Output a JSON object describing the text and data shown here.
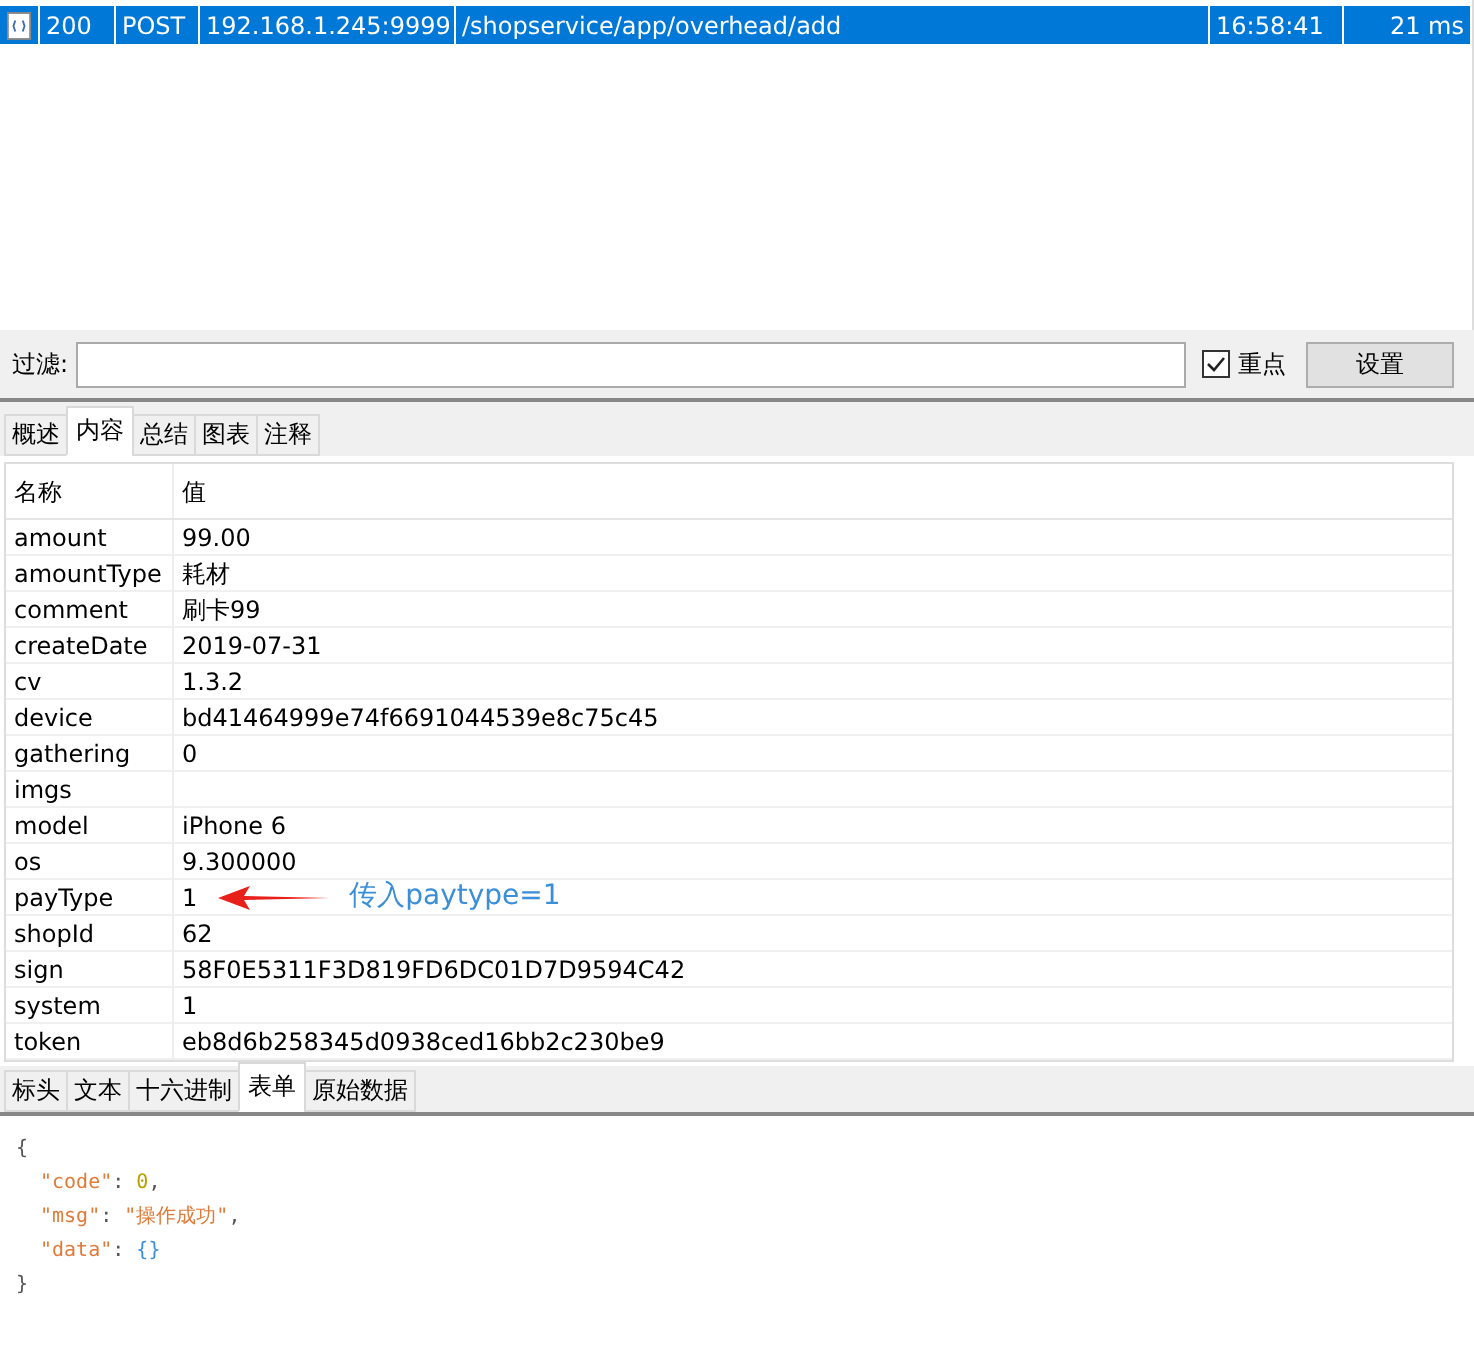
{
  "sessions": [
    {
      "result": "200",
      "method": "POST",
      "host": "192.168.1.245:9999",
      "url": "/shopservice/app/overhead/add",
      "time": "16:58:41",
      "duration": "21 ms",
      "selected": true
    }
  ],
  "filter": {
    "label": "过滤:",
    "emphasis_label": "重点",
    "emphasis_checked": true,
    "settings_button": "设置"
  },
  "tabs": [
    {
      "label": "概述",
      "selected": false
    },
    {
      "label": "内容",
      "selected": true
    },
    {
      "label": "总结",
      "selected": false
    },
    {
      "label": "图表",
      "selected": false
    },
    {
      "label": "注释",
      "selected": false
    }
  ],
  "table": {
    "columns": [
      "名称",
      "值"
    ],
    "rows": [
      {
        "name": "amount",
        "value": "99.00"
      },
      {
        "name": "amountType",
        "value": "耗材"
      },
      {
        "name": "comment",
        "value": "刷卡99"
      },
      {
        "name": "createDate",
        "value": "2019-07-31"
      },
      {
        "name": "cv",
        "value": "1.3.2"
      },
      {
        "name": "device",
        "value": "bd41464999e74f6691044539e8c75c45"
      },
      {
        "name": "gathering",
        "value": "0"
      },
      {
        "name": "imgs",
        "value": ""
      },
      {
        "name": "model",
        "value": "iPhone 6"
      },
      {
        "name": "os",
        "value": "9.300000"
      },
      {
        "name": "payType",
        "value": "1",
        "annotation": "传入paytype=1"
      },
      {
        "name": "shopId",
        "value": "62"
      },
      {
        "name": "sign",
        "value": "58F0E5311F3D819FD6DC01D7D9594C42"
      },
      {
        "name": "system",
        "value": "1"
      },
      {
        "name": "token",
        "value": "eb8d6b258345d0938ced16bb2c230be9"
      }
    ]
  },
  "response_tabs": [
    {
      "label": "标头",
      "selected": false
    },
    {
      "label": "文本",
      "selected": false
    },
    {
      "label": "十六进制",
      "selected": false
    },
    {
      "label": "表单",
      "selected": true
    },
    {
      "label": "原始数据",
      "selected": false
    }
  ],
  "response_lines": [
    [
      {
        "kind": "punct",
        "text": "{"
      }
    ],
    [
      {
        "kind": "key",
        "text": "\"code\""
      },
      {
        "kind": "punct",
        "text": ": "
      },
      {
        "kind": "number",
        "text": "0"
      },
      {
        "kind": "punct",
        "text": ","
      }
    ],
    [
      {
        "kind": "key",
        "text": "\"msg\""
      },
      {
        "kind": "punct",
        "text": ": "
      },
      {
        "kind": "string",
        "text": "\"操作成功\""
      },
      {
        "kind": "punct",
        "text": ","
      }
    ],
    [
      {
        "kind": "key",
        "text": "\"data\""
      },
      {
        "kind": "punct",
        "text": ": "
      },
      {
        "kind": "bracket",
        "text": "{}"
      }
    ],
    [
      {
        "kind": "punct",
        "text": "}"
      }
    ]
  ]
}
